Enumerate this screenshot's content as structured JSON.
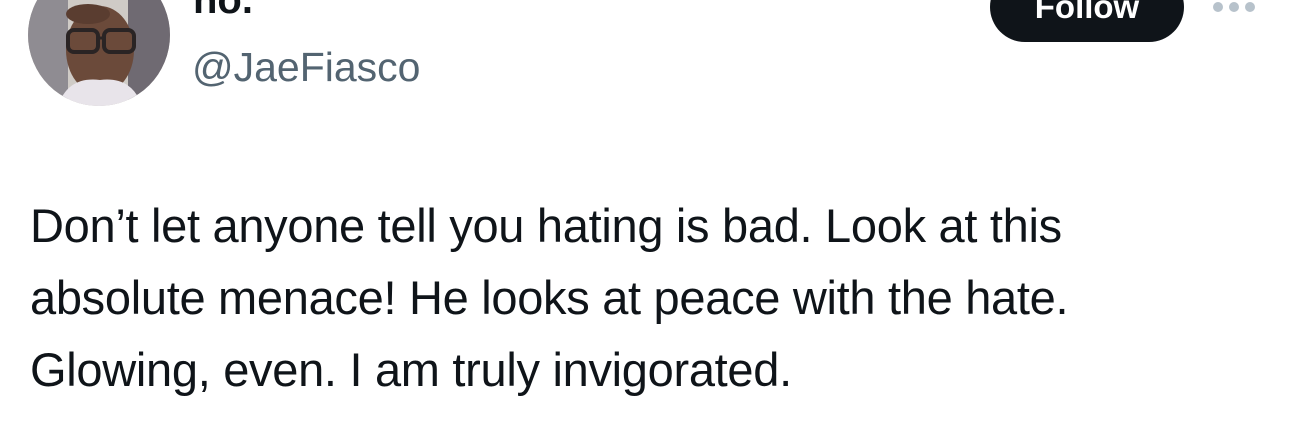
{
  "author": {
    "display_name": "no.",
    "handle": "@JaeFiasco"
  },
  "actions": {
    "follow_label": "Follow",
    "more_icon": "more-horizontal-icon"
  },
  "tweet": {
    "lines": [
      "Don’t let anyone tell you hating is bad. Look at this",
      "absolute menace! He looks at peace with the hate.",
      "Glowing, even. I am truly invigorated."
    ]
  }
}
